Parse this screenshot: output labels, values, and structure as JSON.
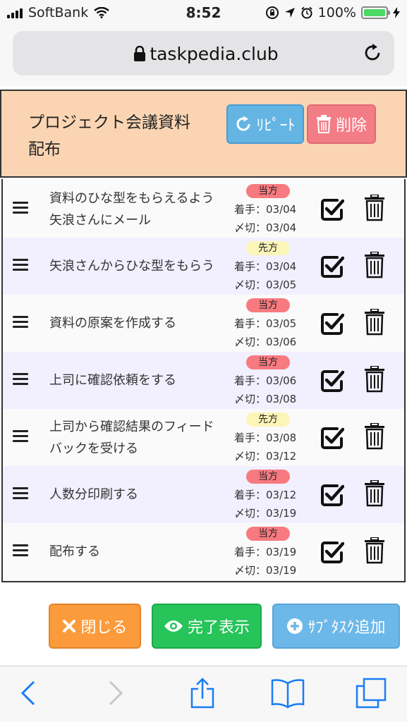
{
  "status_bar": {
    "carrier": "SoftBank",
    "time": "8:52",
    "battery_percent": "100%",
    "battery_level": 1.0
  },
  "browser": {
    "url": "taskpedia.club"
  },
  "project": {
    "title": "プロジェクト会議資料配布",
    "repeat_label": "ﾘﾋﾟｰﾄ",
    "delete_label": "削除"
  },
  "tasks": [
    {
      "text": "資料のひな型をもらえるよう矢浪さんにメール",
      "badge": "当方",
      "badge_color": "#f77a80",
      "start": "着手：03/04",
      "due": "〆切：03/04"
    },
    {
      "text": "矢浪さんからひな型をもらう",
      "badge": "先方",
      "badge_color": "#fbf5b8",
      "start": "着手：03/04",
      "due": "〆切：03/05"
    },
    {
      "text": "資料の原案を作成する",
      "badge": "当方",
      "badge_color": "#f77a80",
      "start": "着手：03/05",
      "due": "〆切：03/06"
    },
    {
      "text": "上司に確認依頼をする",
      "badge": "当方",
      "badge_color": "#f77a80",
      "start": "着手：03/06",
      "due": "〆切：03/08"
    },
    {
      "text": "上司から確認結果のフィードバックを受ける",
      "badge": "先方",
      "badge_color": "#fbf5b8",
      "start": "着手：03/08",
      "due": "〆切：03/12"
    },
    {
      "text": "人数分印刷する",
      "badge": "当方",
      "badge_color": "#f77a80",
      "start": "着手：03/12",
      "due": "〆切：03/19"
    },
    {
      "text": "配布する",
      "badge": "当方",
      "badge_color": "#f77a80",
      "start": "着手：03/19",
      "due": "〆切：03/19"
    }
  ],
  "actions": {
    "close_label": "閉じる",
    "show_done_label": "完了表示",
    "add_subtask_label": "ｻﾌﾞﾀｽｸ追加"
  },
  "colors": {
    "header_bg": "#fbd5b3",
    "row_alt": "#f2efff",
    "repeat": "#64b5e3",
    "delete": "#f37d86",
    "close": "#fb9b3b",
    "done": "#27c45a",
    "add": "#6cb8e8",
    "toolbar_accent": "#1a7cf5"
  },
  "icons": {
    "task_check": "check-square-icon",
    "task_trash": "trash-icon",
    "drag": "drag-handle-icon"
  }
}
